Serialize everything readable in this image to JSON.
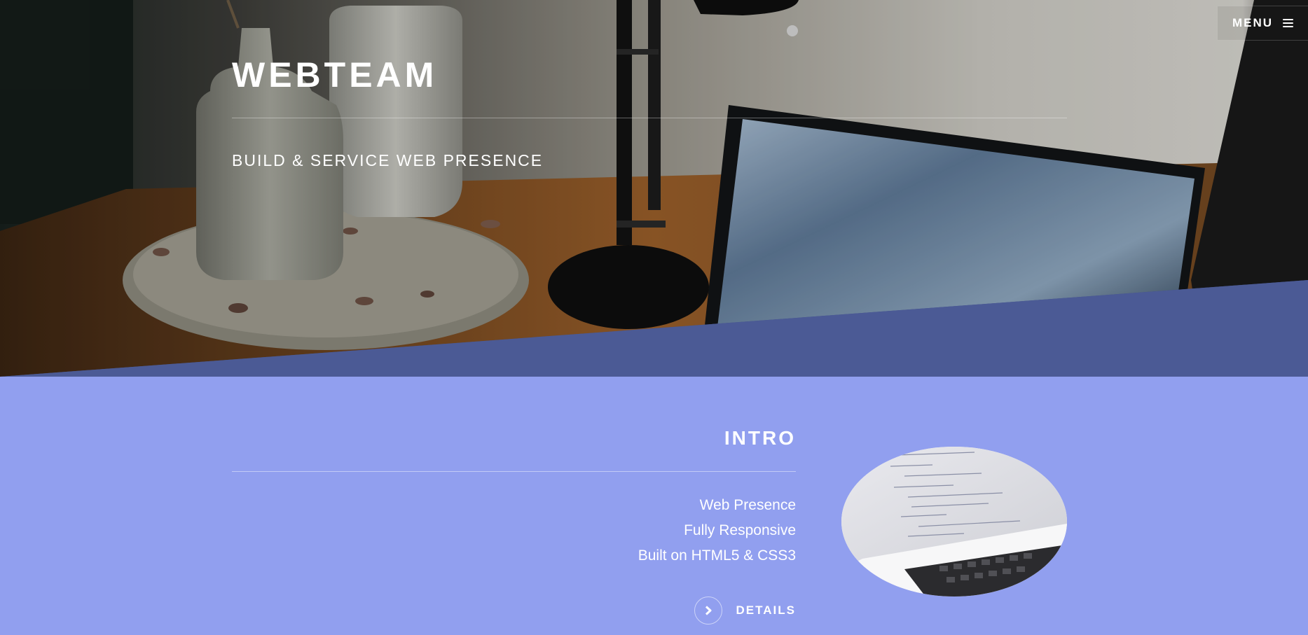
{
  "header": {
    "menu_label": "MENU",
    "menu_icon": "hamburger-icon"
  },
  "hero": {
    "title": "WEBTEAM",
    "tagline": "BUILD & SERVICE WEB PRESENCE"
  },
  "intro": {
    "title": "INTRO",
    "features": [
      "Web Presence",
      "Fully Responsive",
      "Built on HTML5 & CSS3"
    ],
    "details_label": "DETAILS",
    "details_icon": "chevron-right-icon"
  },
  "colors": {
    "hero_band": "#4b5a95",
    "intro_background": "#919fef",
    "text": "#ffffff"
  }
}
